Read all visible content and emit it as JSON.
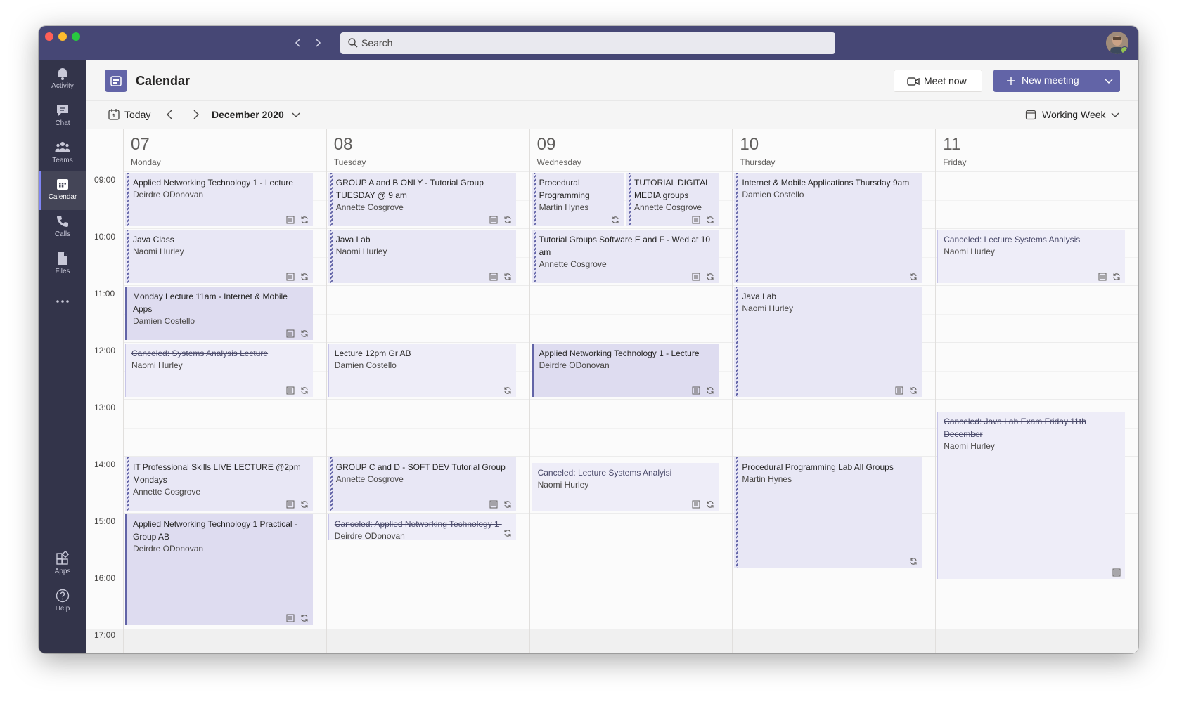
{
  "search": {
    "placeholder": "Search"
  },
  "rail": [
    {
      "key": "activity",
      "label": "Activity",
      "icon": "bell-icon"
    },
    {
      "key": "chat",
      "label": "Chat",
      "icon": "chat-icon"
    },
    {
      "key": "teams",
      "label": "Teams",
      "icon": "teams-icon"
    },
    {
      "key": "calendar",
      "label": "Calendar",
      "icon": "calendar-icon",
      "active": true
    },
    {
      "key": "calls",
      "label": "Calls",
      "icon": "phone-icon"
    },
    {
      "key": "files",
      "label": "Files",
      "icon": "file-icon"
    },
    {
      "key": "more",
      "label": "",
      "icon": "more-icon"
    },
    {
      "key": "apps",
      "label": "Apps",
      "icon": "apps-icon"
    },
    {
      "key": "help",
      "label": "Help",
      "icon": "help-icon"
    }
  ],
  "header": {
    "title": "Calendar",
    "meet_now": "Meet now",
    "new_meeting": "New meeting"
  },
  "toolbar": {
    "today": "Today",
    "month": "December 2020",
    "view": "Working Week"
  },
  "days": [
    {
      "num": "07",
      "name": "Monday"
    },
    {
      "num": "08",
      "name": "Tuesday"
    },
    {
      "num": "09",
      "name": "Wednesday"
    },
    {
      "num": "10",
      "name": "Thursday"
    },
    {
      "num": "11",
      "name": "Friday"
    }
  ],
  "hours": [
    "09:00",
    "10:00",
    "11:00",
    "12:00",
    "13:00",
    "14:00",
    "15:00",
    "16:00",
    "17:00"
  ],
  "events": [
    {
      "day": 0,
      "start": 9.0,
      "end": 10.0,
      "title": "Applied Networking Technology 1 - Lecture",
      "organizer": "Deirdre ODonovan",
      "style": "tent",
      "icons": [
        "notes",
        "sync"
      ]
    },
    {
      "day": 0,
      "start": 10.0,
      "end": 11.0,
      "title": "Java Class",
      "organizer": "Naomi Hurley",
      "style": "tent",
      "icons": [
        "notes",
        "sync"
      ]
    },
    {
      "day": 0,
      "start": 11.0,
      "end": 12.0,
      "title": "Monday Lecture 11am - Internet & Mobile Apps",
      "organizer": "Damien Costello",
      "style": "solid",
      "icons": [
        "notes",
        "sync"
      ]
    },
    {
      "day": 0,
      "start": 12.0,
      "end": 13.0,
      "title": "Canceled: Systems Analysis Lecture",
      "organizer": "Naomi Hurley",
      "style": "cancel",
      "icons": [
        "notes",
        "sync"
      ]
    },
    {
      "day": 0,
      "start": 14.0,
      "end": 15.0,
      "title": "IT Professional Skills LIVE LECTURE @2pm Mondays",
      "organizer": "Annette Cosgrove",
      "style": "tent",
      "icons": [
        "notes",
        "sync"
      ]
    },
    {
      "day": 0,
      "start": 15.0,
      "end": 17.0,
      "title": "Applied Networking Technology 1 Practical - Group AB",
      "organizer": "Deirdre ODonovan",
      "style": "solid",
      "icons": [
        "notes",
        "sync"
      ]
    },
    {
      "day": 1,
      "start": 9.0,
      "end": 10.0,
      "title": "GROUP A and B ONLY - Tutorial Group TUESDAY @ 9 am",
      "organizer": "Annette Cosgrove",
      "style": "tent",
      "icons": [
        "notes",
        "sync"
      ]
    },
    {
      "day": 1,
      "start": 10.0,
      "end": 11.0,
      "title": "Java Lab",
      "organizer": "Naomi Hurley",
      "style": "tent",
      "icons": [
        "notes",
        "sync"
      ]
    },
    {
      "day": 1,
      "start": 12.0,
      "end": 13.0,
      "title": "Lecture 12pm Gr AB",
      "organizer": "Damien Costello",
      "style": "cancel",
      "icons": [
        "sync"
      ]
    },
    {
      "day": 1,
      "start": 14.0,
      "end": 15.0,
      "title": "GROUP C and D - SOFT DEV Tutorial Group",
      "organizer": "Annette Cosgrove",
      "style": "tent",
      "icons": [
        "notes",
        "sync"
      ]
    },
    {
      "day": 1,
      "start": 15.0,
      "end": 15.5,
      "title": "Canceled: Applied Networking Technology 1-",
      "organizer": "Deirdre ODonovan",
      "style": "cancel",
      "icons": [
        "sync"
      ]
    },
    {
      "day": 2,
      "start": 9.0,
      "end": 10.0,
      "title": "Procedural Programming",
      "organizer": "Martin Hynes",
      "style": "tent",
      "half": 0,
      "icons": [
        "sync"
      ]
    },
    {
      "day": 2,
      "start": 9.0,
      "end": 10.0,
      "title": "TUTORIAL DIGITAL MEDIA groups",
      "organizer": "Annette Cosgrove",
      "style": "tent",
      "half": 1,
      "icons": [
        "notes",
        "sync"
      ]
    },
    {
      "day": 2,
      "start": 10.0,
      "end": 11.0,
      "title": "Tutorial Groups Software E and F - Wed at 10 am",
      "organizer": "Annette Cosgrove",
      "style": "tent",
      "icons": [
        "notes",
        "sync"
      ]
    },
    {
      "day": 2,
      "start": 12.0,
      "end": 13.0,
      "title": "Applied Networking Technology 1 - Lecture",
      "organizer": "Deirdre ODonovan",
      "style": "solid",
      "icons": [
        "notes",
        "sync"
      ]
    },
    {
      "day": 2,
      "start": 14.1,
      "end": 15.0,
      "title": "Canceled: Lecture Systems Analyisi",
      "organizer": "Naomi Hurley",
      "style": "cancel",
      "icons": [
        "notes",
        "sync"
      ]
    },
    {
      "day": 3,
      "start": 9.0,
      "end": 11.0,
      "title": "Internet & Mobile Applications Thursday 9am",
      "organizer": "Damien Costello",
      "style": "tent",
      "icons": [
        "sync"
      ]
    },
    {
      "day": 3,
      "start": 11.0,
      "end": 13.0,
      "title": "Java Lab",
      "organizer": "Naomi Hurley",
      "style": "tent",
      "icons": [
        "notes",
        "sync"
      ]
    },
    {
      "day": 3,
      "start": 14.0,
      "end": 16.0,
      "title": "Procedural Programming Lab All Groups",
      "organizer": "Martin Hynes",
      "style": "tent",
      "icons": [
        "sync"
      ]
    },
    {
      "day": 4,
      "start": 10.0,
      "end": 11.0,
      "title": "Canceled: Lecture Systems Analysis",
      "organizer": "Naomi Hurley",
      "style": "cancel",
      "icons": [
        "notes",
        "sync"
      ]
    },
    {
      "day": 4,
      "start": 13.2,
      "end": 16.2,
      "title": "Canceled: Java Lab Exam Friday 11th December",
      "organizer": "Naomi Hurley",
      "style": "cancel",
      "icons": [
        "notes"
      ]
    }
  ]
}
